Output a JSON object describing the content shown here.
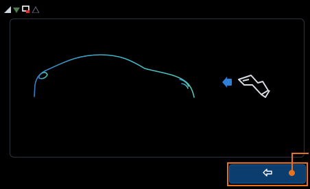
{
  "status_bar": {
    "icons": [
      "signal-icon",
      "wifi-icon",
      "charging-plug-status-icon",
      "warning-icon"
    ]
  },
  "main": {
    "illustration": "car-silhouette-with-charging-plug",
    "icons": [
      "car-silhouette-icon",
      "charge-arrow-icon",
      "charging-plug-icon"
    ]
  },
  "footer": {
    "back_button_icon": "back-arrow-icon"
  },
  "colors": {
    "background": "#000000",
    "panel_border": "#2d3440",
    "car_outline": "#3fb8c9",
    "arrow": "#2e7fd6",
    "plug": "#d8dde2",
    "button": "#0b3d6e",
    "callout": "#e8731f"
  }
}
